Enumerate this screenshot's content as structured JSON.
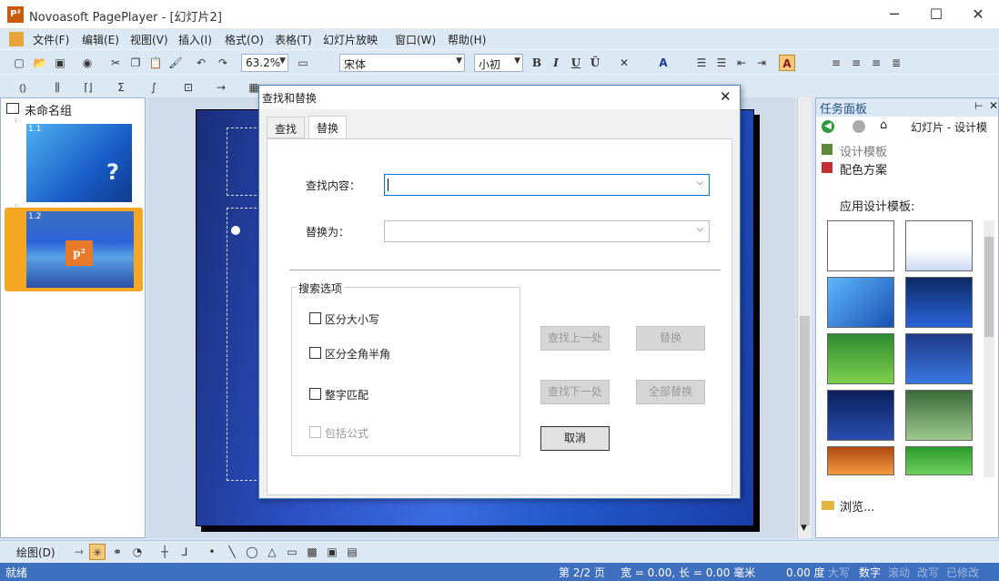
{
  "window": {
    "title": "Novoasoft PagePlayer - [幻灯片2]",
    "app_icon": "P²",
    "minimize": "─",
    "maximize": "☐",
    "close": "✕"
  },
  "menu": [
    "文件(F)",
    "编辑(E)",
    "视图(V)",
    "插入(I)",
    "格式(O)",
    "表格(T)",
    "幻灯片放映",
    "窗口(W)",
    "帮助(H)"
  ],
  "toolbar": {
    "zoom": "63.2%",
    "font": "宋体",
    "size": "小初",
    "bold": "B",
    "italic": "I",
    "underline": "U",
    "accent": "Ũ"
  },
  "outline": {
    "group": "未命名组",
    "slides": [
      {
        "label": "1.1"
      },
      {
        "label": "1.2",
        "badge": "p²"
      }
    ]
  },
  "task_pane": {
    "title": "任务面板",
    "nav_title": "幻灯片 - 设计模",
    "links": [
      "设计模板",
      "配色方案"
    ],
    "section": "应用设计模板:",
    "browse": "浏览..."
  },
  "bottom": {
    "draw": "绘图(D)"
  },
  "status": {
    "ready": "就绪",
    "page": "第 2/2 页",
    "size": "宽 =  0.00, 长 =  0.00 毫米",
    "angle": "0.00 度",
    "caps": "大写",
    "num": "数字",
    "scroll": "滚动",
    "ovr": "改写",
    "rec": "已修改"
  },
  "dialog": {
    "title": "查找和替换",
    "close": "✕",
    "tabs": [
      "查找",
      "替换"
    ],
    "find_label": "查找内容：",
    "find_value": "",
    "replace_label": "替换为：",
    "replace_value": "",
    "options_title": "搜索选项",
    "options": [
      "区分大小写",
      "区分全角半角",
      "整字匹配",
      "包括公式"
    ],
    "buttons": {
      "find_prev": "查找上一处",
      "replace": "替换",
      "find_next": "查找下一处",
      "replace_all": "全部替换",
      "cancel": "取消"
    }
  },
  "colors": {
    "accent": "#4a7ebb",
    "statusbar": "#3f6fbf",
    "selected_thumb": "#f5a623"
  }
}
